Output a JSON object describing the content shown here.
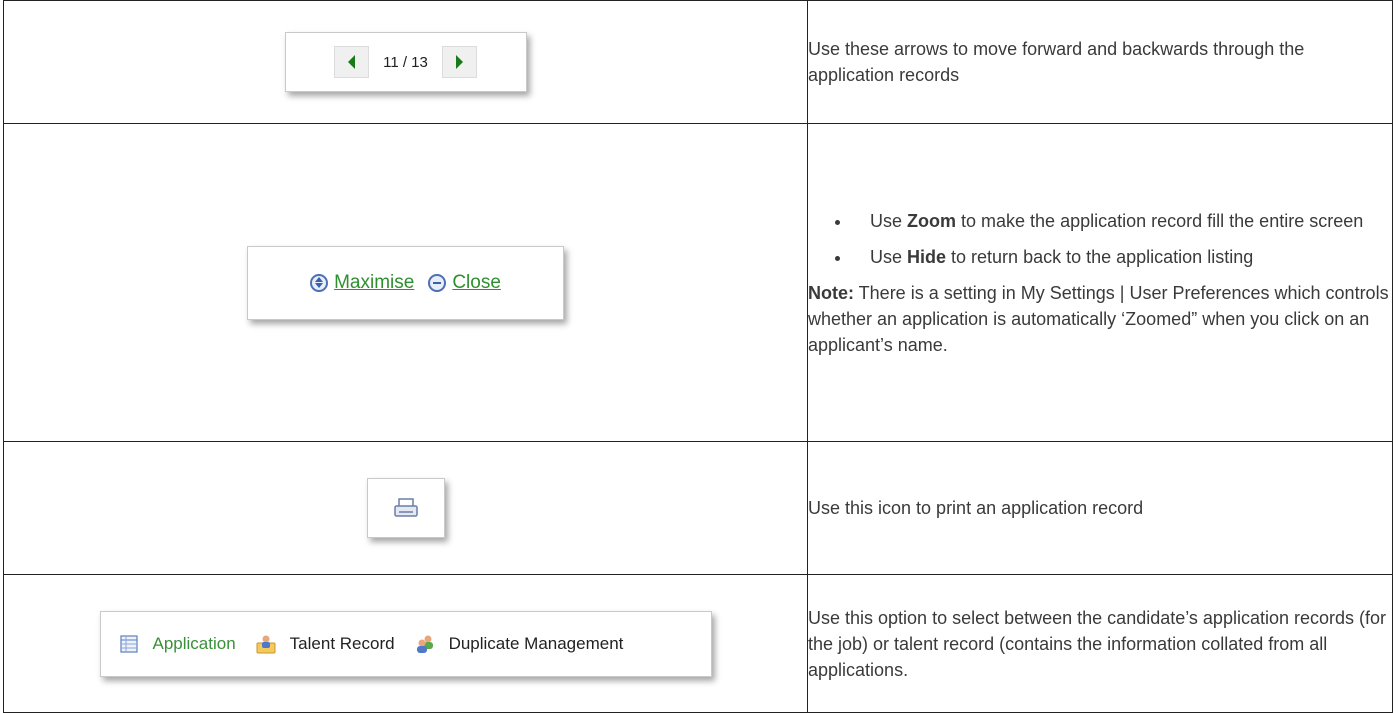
{
  "pager": {
    "count": "11 / 13"
  },
  "maximise": {
    "maximise_label": "Maximise",
    "close_label": "Close"
  },
  "tabs": {
    "application": "Application",
    "talent_record": "Talent Record",
    "duplicate_management": "Duplicate Management"
  },
  "rows": {
    "nav_text": "Use these arrows to move forward and backwards through the application records",
    "zoom_bullet_1": {
      "pre": "Use ",
      "bold": "Zoom",
      "post": " to make the application record fill the entire screen"
    },
    "zoom_bullet_2": {
      "pre": "Use ",
      "bold": "Hide",
      "post": " to return back to the application listing"
    },
    "note": {
      "label": "Note:",
      "text": " There is a setting in My Settings | User Preferences which controls whether an application is automatically ‘Zoomed” when you click on an applicant’s name."
    },
    "print_text": "Use this icon to print an application record",
    "tabs_text": "Use this option to select between the candidate’s application records (for the job) or talent record (contains the information collated from all applications."
  },
  "colors": {
    "link_green": "#2f8f2f",
    "arrow_green": "#1a7a1a",
    "icon_blue": "#4c6fb5"
  }
}
